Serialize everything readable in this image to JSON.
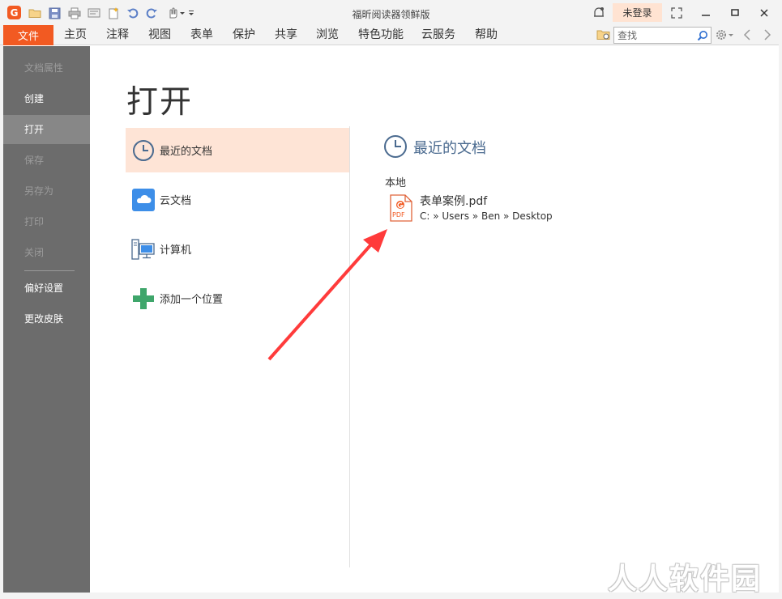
{
  "app": {
    "window_title": "福昕阅读器领鲜版",
    "logo_letter": "G",
    "login_label": "未登录"
  },
  "menu": {
    "file_label": "文件",
    "items": [
      "主页",
      "注释",
      "视图",
      "表单",
      "保护",
      "共享",
      "浏览",
      "特色功能",
      "云服务",
      "帮助"
    ],
    "search_placeholder": "查找"
  },
  "sidebar": {
    "items": [
      {
        "label": "文档属性",
        "state": "disabled"
      },
      {
        "label": "创建",
        "state": "enabled"
      },
      {
        "label": "打开",
        "state": "active"
      },
      {
        "label": "保存",
        "state": "disabled"
      },
      {
        "label": "另存为",
        "state": "disabled"
      },
      {
        "label": "打印",
        "state": "disabled"
      },
      {
        "label": "关闭",
        "state": "disabled"
      },
      {
        "label": "偏好设置",
        "state": "enabled"
      },
      {
        "label": "更改皮肤",
        "state": "enabled"
      }
    ]
  },
  "main": {
    "page_title": "打开",
    "locations": [
      {
        "label": "最近的文档",
        "icon": "clock-icon",
        "active": true
      },
      {
        "label": "云文档",
        "icon": "cloud-icon",
        "active": false
      },
      {
        "label": "计算机",
        "icon": "computer-icon",
        "active": false
      },
      {
        "label": "添加一个位置",
        "icon": "plus-icon",
        "active": false
      }
    ],
    "recent": {
      "heading": "最近的文档",
      "group_label": "本地",
      "files": [
        {
          "name": "表单案例.pdf",
          "path": "C: » Users » Ben » Desktop",
          "icon": "pdf-file-icon",
          "badge": "PDF"
        }
      ]
    }
  },
  "watermark": "人人软件园",
  "colors": {
    "accent": "#f25a22",
    "sidebar_bg": "#6c6c6c",
    "sidebar_active": "#878787",
    "location_active_bg": "#fee4d6",
    "heading_blue": "#4a6a8f",
    "arrow_red": "#ff3b3b"
  }
}
